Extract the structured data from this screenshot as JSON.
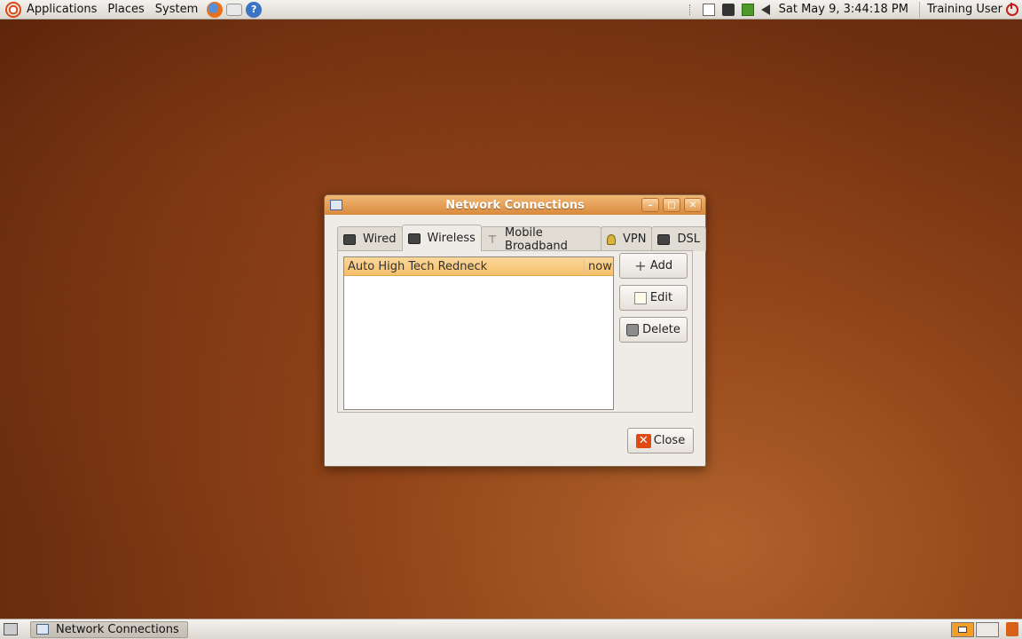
{
  "top_panel": {
    "menus": [
      "Applications",
      "Places",
      "System"
    ],
    "clock": "Sat May  9,  3:44:18 PM",
    "user": "Training User"
  },
  "window": {
    "title": "Network Connections",
    "tabs": [
      {
        "label": "Wired",
        "icon": "wired-icon"
      },
      {
        "label": "Wireless",
        "icon": "wireless-icon",
        "active": true
      },
      {
        "label": "Mobile Broadband",
        "icon": "antenna-icon"
      },
      {
        "label": "VPN",
        "icon": "lock-icon"
      },
      {
        "label": "DSL",
        "icon": "dsl-icon"
      }
    ],
    "connections": [
      {
        "name": "Auto High Tech Redneck",
        "last_used": "now"
      }
    ],
    "buttons": {
      "add": "Add",
      "edit": "Edit",
      "delete": "Delete",
      "close": "Close"
    }
  },
  "bottom_panel": {
    "task": "Network Connections"
  },
  "colors": {
    "titlebar": "#d98a3e",
    "selection": "#f5c06d",
    "desktop": "#8f4318"
  }
}
